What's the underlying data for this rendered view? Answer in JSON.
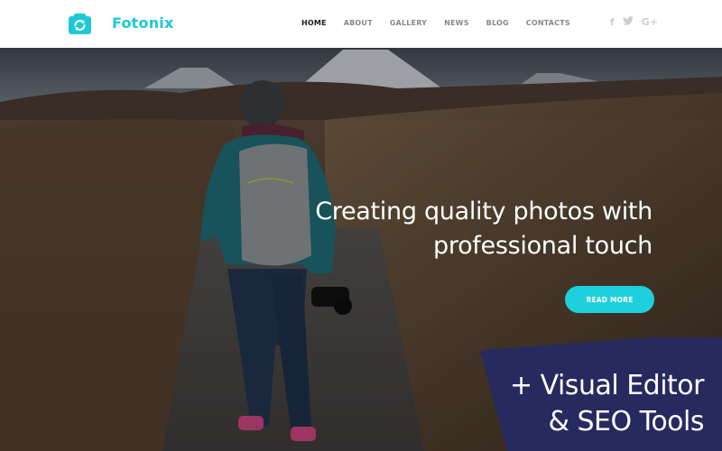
{
  "brand": {
    "name": "Fotonix",
    "logo_icon": "camera-refresh-icon",
    "accent_color": "#1ec8d6"
  },
  "nav": {
    "items": [
      {
        "label": "HOME",
        "active": true
      },
      {
        "label": "ABOUT",
        "active": false
      },
      {
        "label": "GALLERY",
        "active": false
      },
      {
        "label": "NEWS",
        "active": false
      },
      {
        "label": "BLOG",
        "active": false
      },
      {
        "label": "CONTACTS",
        "active": false
      }
    ]
  },
  "social": {
    "items": [
      {
        "icon": "facebook-icon",
        "glyph": "f"
      },
      {
        "icon": "twitter-icon",
        "glyph": "🐦"
      },
      {
        "icon": "google-plus-icon",
        "glyph": "G+"
      }
    ]
  },
  "hero": {
    "title_line1": "Creating quality photos with",
    "title_line2": "professional touch",
    "cta_label": "READ MORE",
    "cta_color": "#1ed0dc",
    "background_image": "hiker-with-camera-on-mountain-trail"
  },
  "promo": {
    "line1": "+ Visual Editor",
    "line2": "& SEO Tools",
    "background_color": "#262a5e"
  }
}
